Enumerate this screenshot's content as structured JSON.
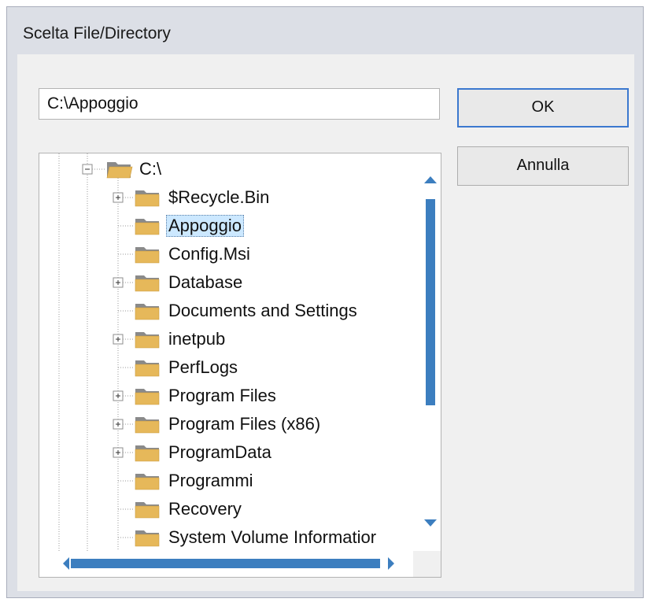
{
  "window": {
    "title": "Scelta File/Directory"
  },
  "path_field": {
    "value": "C:\\Appoggio"
  },
  "buttons": {
    "ok": "OK",
    "cancel": "Annulla"
  },
  "tree": {
    "root": {
      "label": "C:\\",
      "expanded": true
    },
    "items": [
      {
        "label": "$Recycle.Bin",
        "expandable": true,
        "selected": false
      },
      {
        "label": "Appoggio",
        "expandable": false,
        "selected": true
      },
      {
        "label": "Config.Msi",
        "expandable": false,
        "selected": false
      },
      {
        "label": "Database",
        "expandable": true,
        "selected": false
      },
      {
        "label": "Documents and Settings",
        "expandable": false,
        "selected": false
      },
      {
        "label": "inetpub",
        "expandable": true,
        "selected": false
      },
      {
        "label": "PerfLogs",
        "expandable": false,
        "selected": false
      },
      {
        "label": "Program Files",
        "expandable": true,
        "selected": false
      },
      {
        "label": "Program Files (x86)",
        "expandable": true,
        "selected": false
      },
      {
        "label": "ProgramData",
        "expandable": true,
        "selected": false
      },
      {
        "label": "Programmi",
        "expandable": false,
        "selected": false
      },
      {
        "label": "Recovery",
        "expandable": false,
        "selected": false
      },
      {
        "label": "System Volume Informatior",
        "expandable": false,
        "selected": false
      }
    ]
  },
  "colors": {
    "accent": "#3b78cf",
    "scrollbar": "#3c7ebf",
    "folder": "#e6b85a",
    "selection": "#cce8ff"
  }
}
